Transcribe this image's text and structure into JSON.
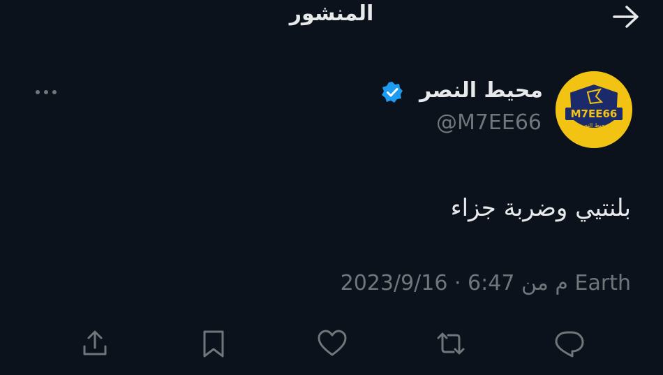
{
  "header": {
    "title": "المنشور"
  },
  "post": {
    "author": {
      "display_name": "محيط النصر",
      "handle": "@M7EE66",
      "verified": true,
      "avatar_text": "M7EE66",
      "avatar_subtext": "محيط النصر"
    },
    "text": "بلنتيي وضربة جزاء",
    "meta": {
      "date": "2023/9/16",
      "separator": "·",
      "time": "6:47 م",
      "location": "من Earth",
      "full": "2023/9/16 · 6:47 م من Earth"
    }
  },
  "actions": [
    {
      "name": "reply",
      "icon": "reply-icon"
    },
    {
      "name": "repost",
      "icon": "repost-icon"
    },
    {
      "name": "like",
      "icon": "heart-icon"
    },
    {
      "name": "bookmark",
      "icon": "bookmark-icon"
    },
    {
      "name": "share",
      "icon": "share-icon"
    }
  ],
  "colors": {
    "background": "#0b121b",
    "text_primary": "#e7e9ea",
    "text_secondary": "#71767b",
    "verified_blue": "#1d9bf0",
    "avatar_yellow": "#f3c313",
    "avatar_navy": "#1b2a6b"
  }
}
